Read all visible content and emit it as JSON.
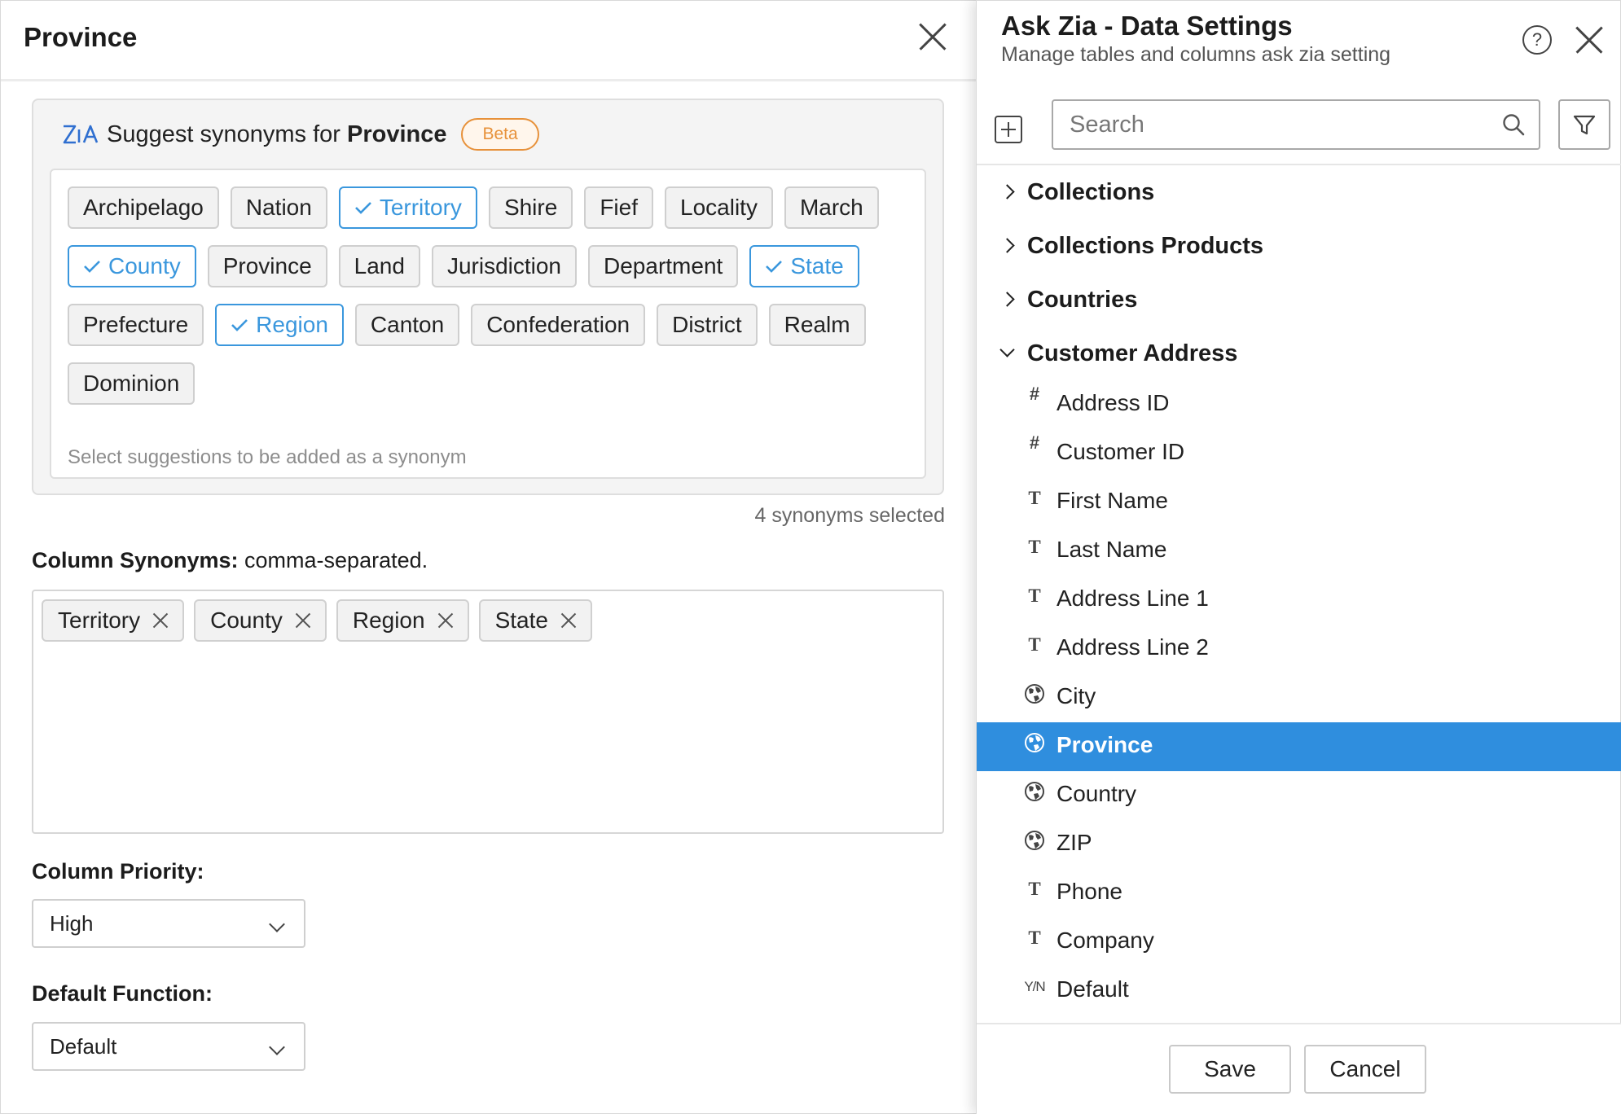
{
  "left_panel": {
    "title": "Province",
    "suggest": {
      "prefix": "Suggest synonyms for ",
      "column": "Province",
      "badge": "Beta",
      "hint": "Select suggestions to be added as a synonym",
      "suggestions": [
        {
          "label": "Archipelago",
          "selected": false
        },
        {
          "label": "Nation",
          "selected": false
        },
        {
          "label": "Territory",
          "selected": true
        },
        {
          "label": "Shire",
          "selected": false
        },
        {
          "label": "Fief",
          "selected": false
        },
        {
          "label": "Locality",
          "selected": false
        },
        {
          "label": "March",
          "selected": false
        },
        {
          "label": "County",
          "selected": true
        },
        {
          "label": "Province",
          "selected": false
        },
        {
          "label": "Land",
          "selected": false
        },
        {
          "label": "Jurisdiction",
          "selected": false
        },
        {
          "label": "Department",
          "selected": false
        },
        {
          "label": "State",
          "selected": true
        },
        {
          "label": "Prefecture",
          "selected": false
        },
        {
          "label": "Region",
          "selected": true
        },
        {
          "label": "Canton",
          "selected": false
        },
        {
          "label": "Confederation",
          "selected": false
        },
        {
          "label": "District",
          "selected": false
        },
        {
          "label": "Realm",
          "selected": false
        },
        {
          "label": "Dominion",
          "selected": false
        }
      ]
    },
    "selected_count": "4 synonyms selected",
    "column_synonyms": {
      "label": "Column Synonyms:",
      "note": " comma-separated.",
      "tags": [
        "Territory",
        "County",
        "Region",
        "State"
      ]
    },
    "column_priority": {
      "label": "Column Priority:",
      "value": "High"
    },
    "default_function": {
      "label": "Default Function:",
      "value": "Default"
    }
  },
  "right_panel": {
    "title": "Ask Zia - Data Settings",
    "subtitle": "Manage tables and columns ask zia setting",
    "help_glyph": "?",
    "search_placeholder": "Search",
    "groups": [
      {
        "label": "Collections",
        "open": false
      },
      {
        "label": "Collections Products",
        "open": false
      },
      {
        "label": "Countries",
        "open": false
      },
      {
        "label": "Customer Address",
        "open": true
      }
    ],
    "columns": [
      {
        "label": "Address ID",
        "type": "number",
        "glyph": "#"
      },
      {
        "label": "Customer ID",
        "type": "number",
        "glyph": "#"
      },
      {
        "label": "First Name",
        "type": "text",
        "glyph": "T"
      },
      {
        "label": "Last Name",
        "type": "text",
        "glyph": "T"
      },
      {
        "label": "Address Line 1",
        "type": "text",
        "glyph": "T"
      },
      {
        "label": "Address Line 2",
        "type": "text",
        "glyph": "T"
      },
      {
        "label": "City",
        "type": "geo",
        "glyph": ""
      },
      {
        "label": "Province",
        "type": "geo",
        "glyph": "",
        "active": true
      },
      {
        "label": "Country",
        "type": "geo",
        "glyph": ""
      },
      {
        "label": "ZIP",
        "type": "geo",
        "glyph": ""
      },
      {
        "label": "Phone",
        "type": "text",
        "glyph": "T"
      },
      {
        "label": "Company",
        "type": "text",
        "glyph": "T"
      },
      {
        "label": "Default",
        "type": "boolean",
        "glyph": "Y/N"
      }
    ],
    "save_label": "Save",
    "cancel_label": "Cancel"
  },
  "colors": {
    "accent": "#2f8ede",
    "selected_chip": "#3a97dd",
    "beta": "#e7913a"
  }
}
